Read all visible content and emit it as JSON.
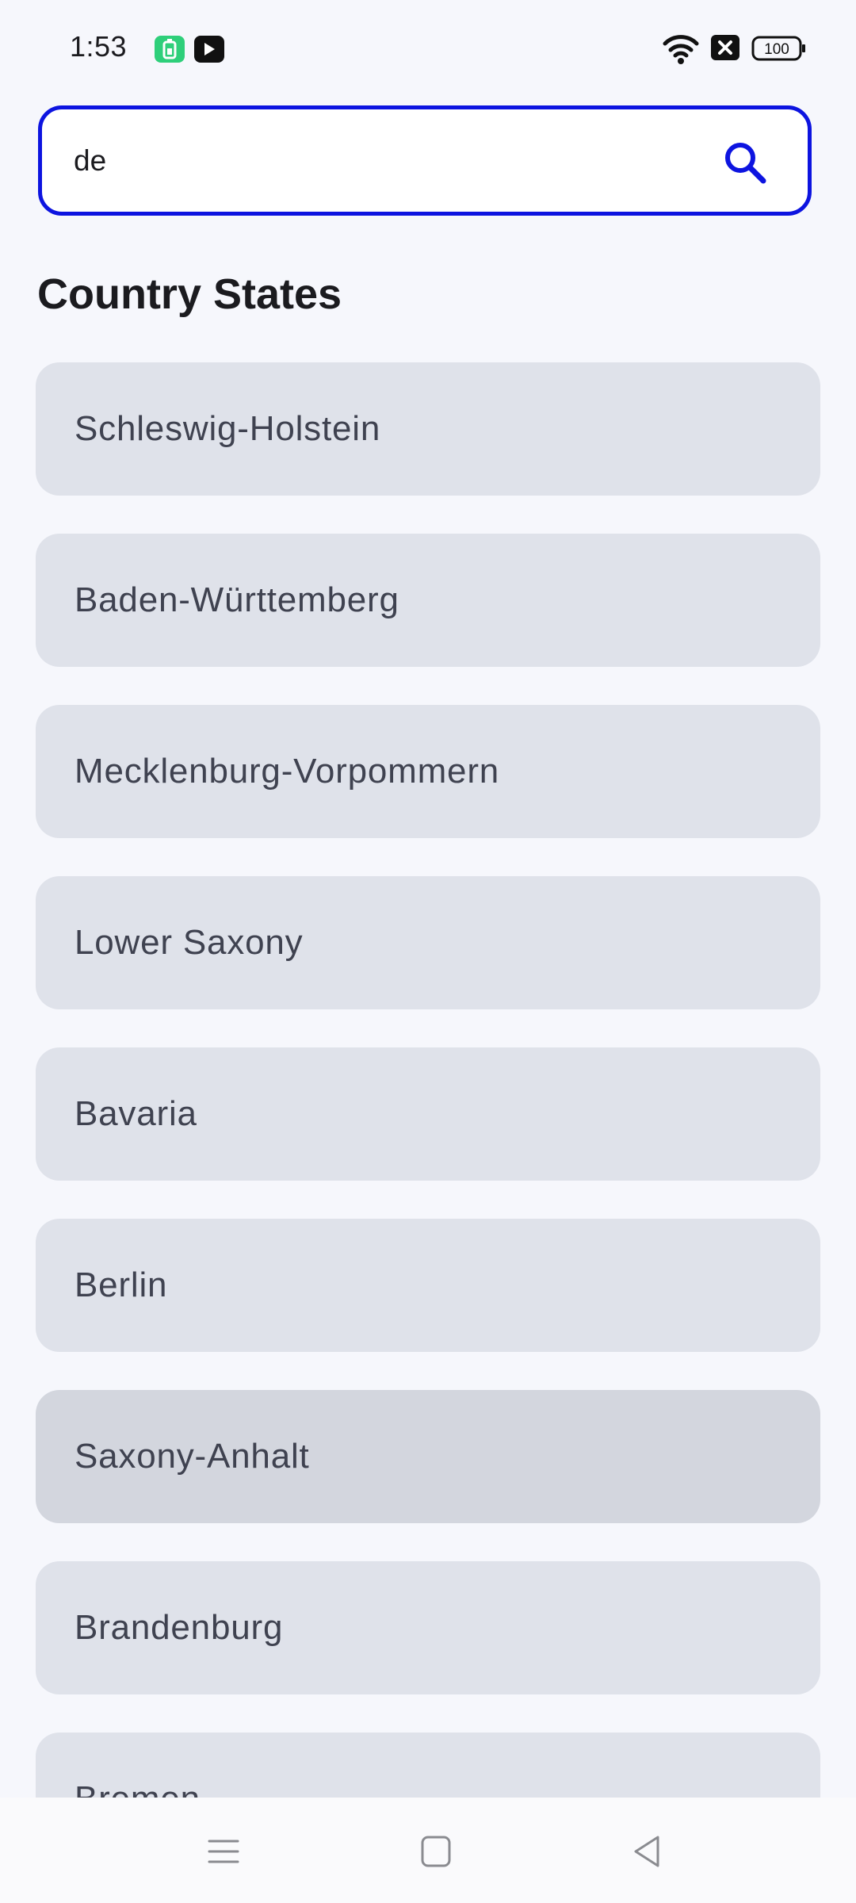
{
  "status_bar": {
    "time": "1:53",
    "battery_level": "100",
    "icons": [
      "battery-saver-app-icon",
      "youtube-app-icon",
      "wifi-icon",
      "no-sim-icon",
      "battery-icon"
    ]
  },
  "search": {
    "value": "de",
    "placeholder": "",
    "icon": "search-icon"
  },
  "page": {
    "title": "Country States"
  },
  "states": [
    {
      "label": "Schleswig-Holstein"
    },
    {
      "label": "Baden-Württemberg"
    },
    {
      "label": "Mecklenburg-Vorpommern"
    },
    {
      "label": "Lower Saxony"
    },
    {
      "label": "Bavaria"
    },
    {
      "label": "Berlin"
    },
    {
      "label": "Saxony-Anhalt",
      "pressed": true
    },
    {
      "label": "Brandenburg"
    },
    {
      "label": "Bremen"
    }
  ],
  "nav_bar": {
    "icons": [
      "menu-icon",
      "home-icon",
      "back-icon"
    ]
  },
  "colors": {
    "accent": "#0d14e0",
    "background": "#f6f7fc",
    "item_background": "#dfe2ea",
    "item_pressed": "#d3d6de",
    "item_text": "#3f4250"
  }
}
